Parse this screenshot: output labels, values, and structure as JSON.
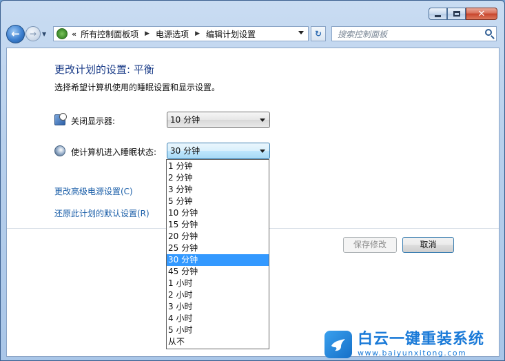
{
  "window": {
    "controls": {
      "minimize": "—",
      "maximize": "□",
      "close": "✕"
    }
  },
  "nav": {
    "back_glyph": "←",
    "forward_glyph": "→",
    "recent_glyph": "▼",
    "address_prefix": "«",
    "breadcrumbs": [
      "所有控制面板项",
      "电源选项",
      "编辑计划设置"
    ],
    "breadcrumb_sep": "▶",
    "refresh_glyph": "↻",
    "search_placeholder": "搜索控制面板"
  },
  "page": {
    "title": "更改计划的设置: 平衡",
    "subtitle": "选择希望计算机使用的睡眠设置和显示设置。",
    "settings": [
      {
        "label": "关闭显示器:",
        "value": "10 分钟",
        "icon": "monitor-icon"
      },
      {
        "label": "使计算机进入睡眠状态:",
        "value": "30 分钟",
        "icon": "sleep-moon-icon"
      }
    ],
    "links": {
      "advanced": "更改高级电源设置(C)",
      "restore": "还原此计划的默认设置(R)"
    },
    "buttons": {
      "save": "保存修改",
      "cancel": "取消"
    }
  },
  "dropdown": {
    "selected": "30 分钟",
    "options": [
      "1 分钟",
      "2 分钟",
      "3 分钟",
      "5 分钟",
      "10 分钟",
      "15 分钟",
      "20 分钟",
      "25 分钟",
      "30 分钟",
      "45 分钟",
      "1 小时",
      "2 小时",
      "3 小时",
      "4 小时",
      "5 小时",
      "从不"
    ]
  },
  "watermark": {
    "name": "白云一键重装系统",
    "url": "www.baiyunxitong.com"
  },
  "colors": {
    "accent": "#3399ff",
    "title_blue": "#1e3f8a",
    "link_blue": "#1a5ea8",
    "watermark_blue": "#1a7ad8"
  }
}
